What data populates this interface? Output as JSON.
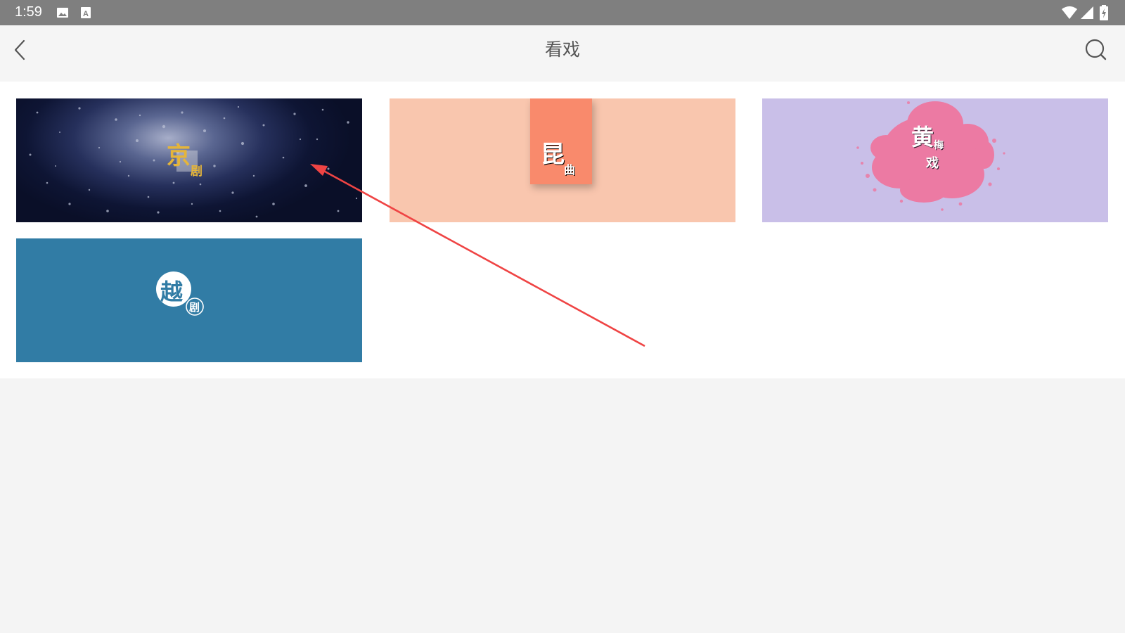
{
  "status_bar": {
    "time": "1:59",
    "icons": [
      "image-icon",
      "a-letter-icon",
      "wifi-icon",
      "cellular-signal-icon",
      "battery-charging-icon"
    ]
  },
  "app_bar": {
    "title": "看戏",
    "back_icon": "back-chevron-icon",
    "search_icon": "search-icon"
  },
  "categories": [
    {
      "big": "京",
      "small": "剧",
      "background": "#0e1534",
      "accent": "#e5b53a"
    },
    {
      "big": "昆",
      "small": "曲",
      "background": "#f9c6ae",
      "accent": "#f98a6c"
    },
    {
      "big": "黄",
      "small": "梅",
      "small2": "戏",
      "background": "#c9bfe8",
      "accent": "#ec7aa3"
    },
    {
      "big": "越",
      "small": "剧",
      "background": "#317ca5",
      "accent": "#ffffff"
    }
  ],
  "colors": {
    "status_bar": "#7f7f7f",
    "app_bar": "#f5f5f5",
    "page_background": "#f4f4f4",
    "annotation_arrow": "#ef4444"
  }
}
